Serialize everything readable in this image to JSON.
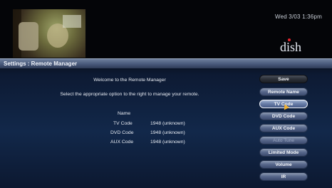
{
  "header": {
    "datetime": "Wed 3/03   1:36pm",
    "logo_text": "dish"
  },
  "breadcrumb": "Settings : Remote Manager",
  "main": {
    "welcome": "Welcome to the Remote Manager",
    "instruction": "Select the appropriate option to the right to manage your remote.",
    "name_header": "Name",
    "rows": [
      {
        "label": "TV Code",
        "value": "1948 (unknown)"
      },
      {
        "label": "DVD Code",
        "value": "1948 (unknown)"
      },
      {
        "label": "AUX Code",
        "value": "1948 (unknown)"
      }
    ]
  },
  "buttons": {
    "save": "Save",
    "remote_name": "Remote Name",
    "tv_code": "TV Code",
    "dvd_code": "DVD Code",
    "aux_code": "AUX Code",
    "auto_tune": "Auto Tune",
    "limited_mode": "Limited Mode",
    "volume": "Volume",
    "ir": "IR"
  },
  "colors": {
    "background": "#12284a",
    "accent": "#e3262e",
    "selected_border": "#f2f4fa"
  }
}
